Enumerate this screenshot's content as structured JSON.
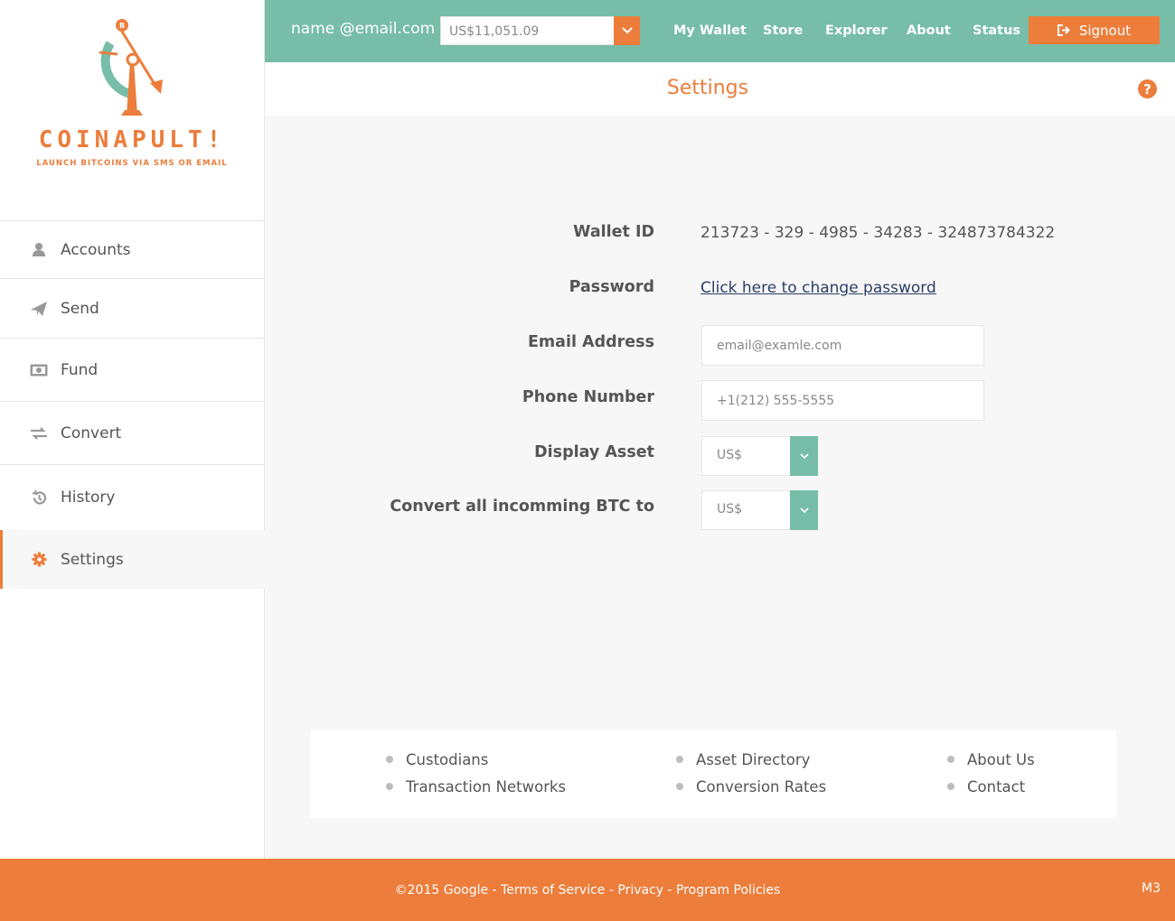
{
  "brand": {
    "name": "COINAPULT!",
    "tagline": "LAUNCH BITCOINS VIA SMS OR EMAIL",
    "colors": {
      "orange": "#ec7d3b",
      "teal": "#77bda8"
    }
  },
  "sidebar": {
    "items": [
      {
        "label": "Accounts",
        "icon": "user-icon"
      },
      {
        "label": "Send",
        "icon": "paper-plane-icon"
      },
      {
        "label": "Fund",
        "icon": "money-icon"
      },
      {
        "label": "Convert",
        "icon": "exchange-arrows-icon"
      },
      {
        "label": "History",
        "icon": "history-icon"
      },
      {
        "label": "Settings",
        "icon": "gear-icon",
        "active": true
      }
    ]
  },
  "topbar": {
    "user_email": "name @email.com",
    "balance": "US$11,051.09",
    "links": [
      "My Wallet",
      "Store",
      "Explorer",
      "About",
      "Status"
    ],
    "signout": "Signout"
  },
  "page": {
    "title": "Settings"
  },
  "settings": {
    "wallet_id_label": "Wallet ID",
    "wallet_id": "213723 - 329 - 4985 - 34283 - 324873784322",
    "password_label": "Password",
    "password_link": "Click here to change password",
    "email_label": "Email Address",
    "email_placeholder": "email@examle.com",
    "phone_label": "Phone Number",
    "phone_placeholder": "+1(212) 555-5555",
    "display_asset_label": "Display Asset",
    "display_asset": "US$",
    "convert_label": "Convert all incomming BTC to",
    "convert_asset": "US$"
  },
  "footer_links": {
    "col1": [
      "Custodians",
      "Transaction Networks"
    ],
    "col2": [
      "Asset Directory",
      "Conversion Rates"
    ],
    "col3": [
      "About Us",
      "Contact"
    ]
  },
  "bottom": {
    "copyright": "©2015 Google",
    "sep": " - ",
    "terms": "Terms of Service",
    "privacy": "Privacy",
    "policies": "Program Policies",
    "version": "M3"
  }
}
